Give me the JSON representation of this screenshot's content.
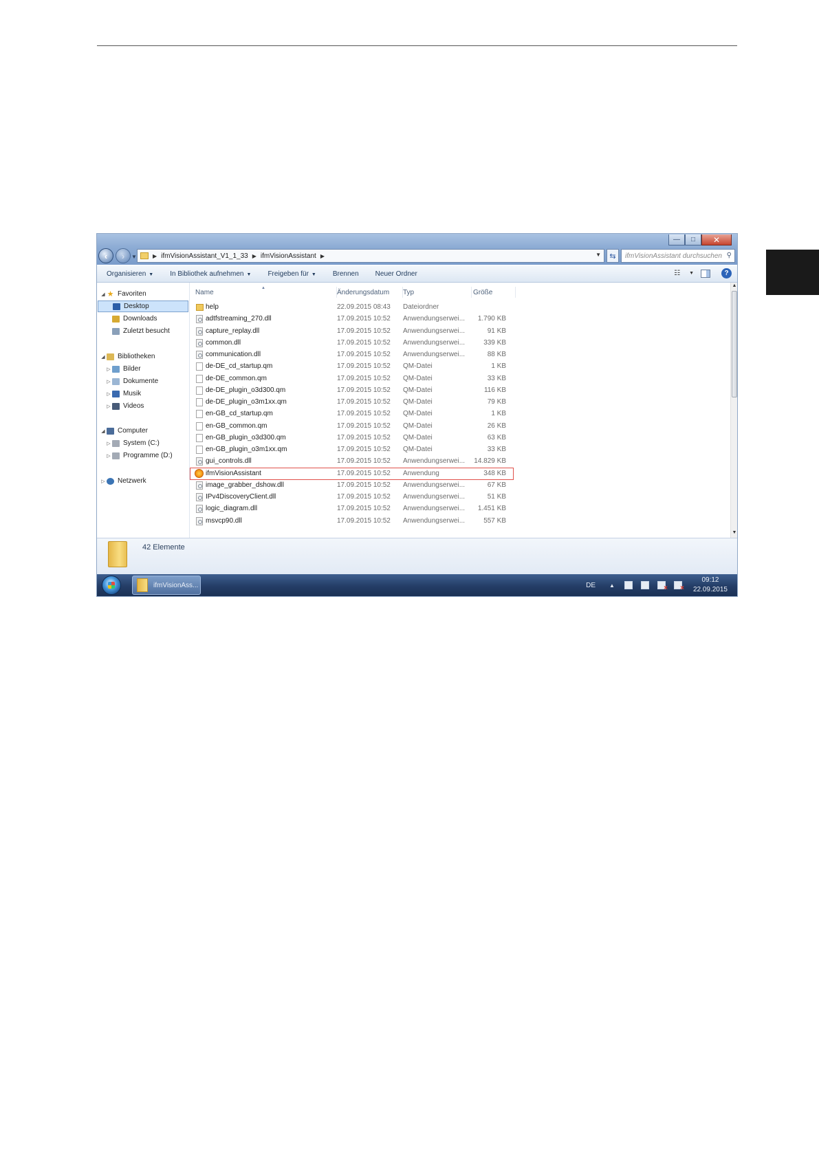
{
  "window": {
    "controls": {
      "minimize": "—",
      "maximize": "□",
      "close": "✕"
    },
    "address": {
      "crumbs": [
        "ifmVisionAssistant_V1_1_33",
        "ifmVisionAssistant"
      ]
    },
    "search": {
      "placeholder": "ifmVisionAssistant durchsuchen"
    }
  },
  "toolbar": {
    "organize": "Organisieren",
    "include_library": "In Bibliothek aufnehmen",
    "share": "Freigeben für",
    "burn": "Brennen",
    "new_folder": "Neuer Ordner"
  },
  "sidebar": {
    "favorites": {
      "label": "Favoriten",
      "items": [
        "Desktop",
        "Downloads",
        "Zuletzt besucht"
      ]
    },
    "libraries": {
      "label": "Bibliotheken",
      "items": [
        "Bilder",
        "Dokumente",
        "Musik",
        "Videos"
      ]
    },
    "computer": {
      "label": "Computer",
      "items": [
        "System (C:)",
        "Programme (D:)"
      ]
    },
    "network": {
      "label": "Netzwerk"
    },
    "selected": "Desktop"
  },
  "columns": {
    "name": "Name",
    "date": "Änderungsdatum",
    "type": "Typ",
    "size": "Größe"
  },
  "files": [
    {
      "name": "help",
      "date": "22.09.2015 08:43",
      "type": "Dateiordner",
      "size": "",
      "icon": "folder-icon"
    },
    {
      "name": "adtfstreaming_270.dll",
      "date": "17.09.2015 10:52",
      "type": "Anwendungserwei...",
      "size": "1.790 KB",
      "icon": "dll-icon"
    },
    {
      "name": "capture_replay.dll",
      "date": "17.09.2015 10:52",
      "type": "Anwendungserwei...",
      "size": "91 KB",
      "icon": "dll-icon"
    },
    {
      "name": "common.dll",
      "date": "17.09.2015 10:52",
      "type": "Anwendungserwei...",
      "size": "339 KB",
      "icon": "dll-icon"
    },
    {
      "name": "communication.dll",
      "date": "17.09.2015 10:52",
      "type": "Anwendungserwei...",
      "size": "88 KB",
      "icon": "dll-icon"
    },
    {
      "name": "de-DE_cd_startup.qm",
      "date": "17.09.2015 10:52",
      "type": "QM-Datei",
      "size": "1 KB",
      "icon": "qm-file-icon"
    },
    {
      "name": "de-DE_common.qm",
      "date": "17.09.2015 10:52",
      "type": "QM-Datei",
      "size": "33 KB",
      "icon": "qm-file-icon"
    },
    {
      "name": "de-DE_plugin_o3d300.qm",
      "date": "17.09.2015 10:52",
      "type": "QM-Datei",
      "size": "116 KB",
      "icon": "qm-file-icon"
    },
    {
      "name": "de-DE_plugin_o3m1xx.qm",
      "date": "17.09.2015 10:52",
      "type": "QM-Datei",
      "size": "79 KB",
      "icon": "qm-file-icon"
    },
    {
      "name": "en-GB_cd_startup.qm",
      "date": "17.09.2015 10:52",
      "type": "QM-Datei",
      "size": "1 KB",
      "icon": "qm-file-icon"
    },
    {
      "name": "en-GB_common.qm",
      "date": "17.09.2015 10:52",
      "type": "QM-Datei",
      "size": "26 KB",
      "icon": "qm-file-icon"
    },
    {
      "name": "en-GB_plugin_o3d300.qm",
      "date": "17.09.2015 10:52",
      "type": "QM-Datei",
      "size": "63 KB",
      "icon": "qm-file-icon"
    },
    {
      "name": "en-GB_plugin_o3m1xx.qm",
      "date": "17.09.2015 10:52",
      "type": "QM-Datei",
      "size": "33 KB",
      "icon": "qm-file-icon"
    },
    {
      "name": "gui_controls.dll",
      "date": "17.09.2015 10:52",
      "type": "Anwendungserwei...",
      "size": "14.829 KB",
      "icon": "dll-icon"
    },
    {
      "name": "ifmVisionAssistant",
      "date": "17.09.2015 10:52",
      "type": "Anwendung",
      "size": "348 KB",
      "icon": "app-icon",
      "highlighted": true
    },
    {
      "name": "image_grabber_dshow.dll",
      "date": "17.09.2015 10:52",
      "type": "Anwendungserwei...",
      "size": "67 KB",
      "icon": "dll-icon"
    },
    {
      "name": "IPv4DiscoveryClient.dll",
      "date": "17.09.2015 10:52",
      "type": "Anwendungserwei...",
      "size": "51 KB",
      "icon": "dll-icon"
    },
    {
      "name": "logic_diagram.dll",
      "date": "17.09.2015 10:52",
      "type": "Anwendungserwei...",
      "size": "1.451 KB",
      "icon": "dll-icon"
    },
    {
      "name": "msvcp90.dll",
      "date": "17.09.2015 10:52",
      "type": "Anwendungserwei...",
      "size": "557 KB",
      "icon": "dll-icon"
    }
  ],
  "details": {
    "count": "42 Elemente"
  },
  "taskbar": {
    "app_label": "ifmVisionAss...",
    "language": "DE",
    "time": "09:12",
    "date": "22.09.2015"
  },
  "colors": {
    "highlight_border": "#e0504a",
    "selection": "#cce3fb",
    "taskbar": "#243d66"
  }
}
